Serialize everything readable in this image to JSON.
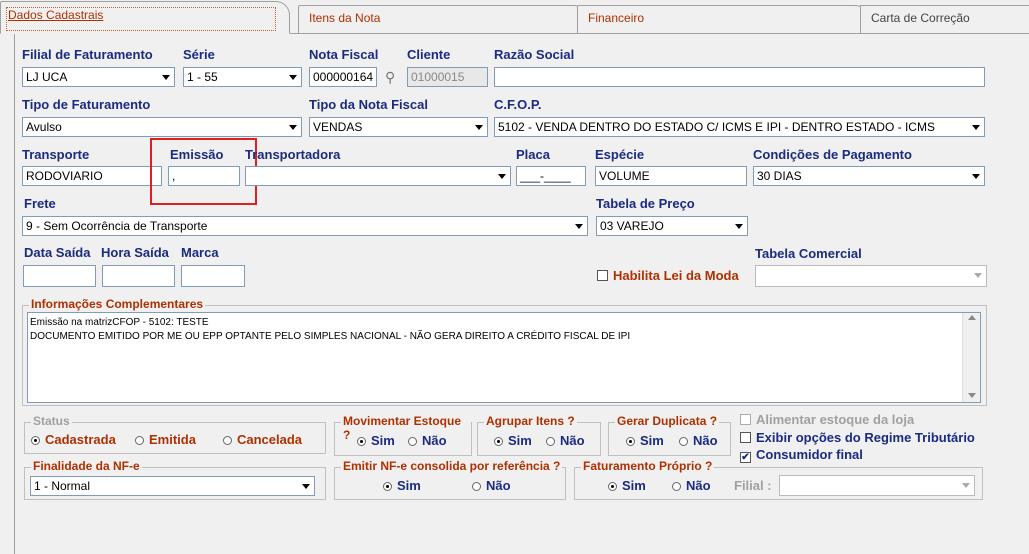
{
  "tabs": [
    {
      "label": "Dados Cadastrais"
    },
    {
      "label": "Itens da Nota"
    },
    {
      "label": "Financeiro"
    },
    {
      "label": "Carta de Correção"
    }
  ],
  "labels": {
    "filial": "Filial de Faturamento",
    "serie": "Série",
    "nota_fiscal": "Nota Fiscal",
    "cliente": "Cliente",
    "razao_social": "Razão Social",
    "tipo_faturamento": "Tipo de Faturamento",
    "tipo_nota": "Tipo da Nota Fiscal",
    "cfop": "C.F.O.P.",
    "transporte": "Transporte",
    "emissao": "Emissão",
    "transportadora": "Transportadora",
    "placa": "Placa",
    "especie": "Espécie",
    "condicoes": "Condições de Pagamento",
    "frete": "Frete",
    "tabela_preco": "Tabela de Preço",
    "data_saida": "Data Saída",
    "hora_saida": "Hora Saída",
    "marca": "Marca",
    "habilita": "Habilita Lei da Moda",
    "tabela_comercial": "Tabela Comercial",
    "info": "Informações Complementares",
    "filial_bottom": "Filial :"
  },
  "fields": {
    "filial": "LJ UCA",
    "serie": "1 - 55",
    "nota_fiscal": "000000164",
    "cliente": "01000015",
    "razao_social": "",
    "tipo_faturamento": "Avulso",
    "tipo_nota": "VENDAS",
    "cfop": "5102 - VENDA DENTRO DO ESTADO C/ ICMS E IPI - DENTRO ESTADO - ICMS",
    "transporte": "RODOVIARIO",
    "emissao": ",",
    "transportadora": "",
    "placa": "___-____",
    "especie": "VOLUME",
    "condicoes": "30 DIAS",
    "frete": "9 - Sem Ocorrência de Transporte",
    "tabela_preco": "03 VAREJO",
    "data_saida": "",
    "hora_saida": "",
    "marca": "",
    "tabela_comercial": "",
    "finalidade": "1 - Normal",
    "filial_bottom": ""
  },
  "info_lines": [
    "Emissão na matrizCFOP - 5102: TESTE",
    "DOCUMENTO EMITIDO POR ME OU EPP OPTANTE PELO SIMPLES NACIONAL - NÃO GERA DIREITO A CRÉDITO FISCAL DE IPI"
  ],
  "groups": {
    "status": {
      "title": "Status",
      "options": [
        "Cadastrada",
        "Emitida",
        "Cancelada"
      ]
    },
    "movimentar": {
      "title": "Movimentar Estoque ?",
      "sim": "Sim",
      "nao": "Não"
    },
    "agrupar": {
      "title": "Agrupar Itens ?",
      "sim": "Sim",
      "nao": "Não"
    },
    "gerar": {
      "title": "Gerar Duplicata ?",
      "sim": "Sim",
      "nao": "Não"
    },
    "finalidade": {
      "title": "Finalidade da NF-e"
    },
    "emitir": {
      "title": "Emitir NF-e consolida por referência ?",
      "sim": "Sim",
      "nao": "Não"
    },
    "faturamento": {
      "title": "Faturamento Próprio ?",
      "sim": "Sim",
      "nao": "Não"
    }
  },
  "checkboxes": {
    "alimentar": "Alimentar estoque da loja",
    "exibir": "Exibir opções do Regime Tributário",
    "consumidor": "Consumidor final",
    "consumidor_mark": "✔"
  },
  "colors": {
    "label_blue": "#1a2b80",
    "label_red": "#b03000",
    "highlight": "#e02020"
  }
}
